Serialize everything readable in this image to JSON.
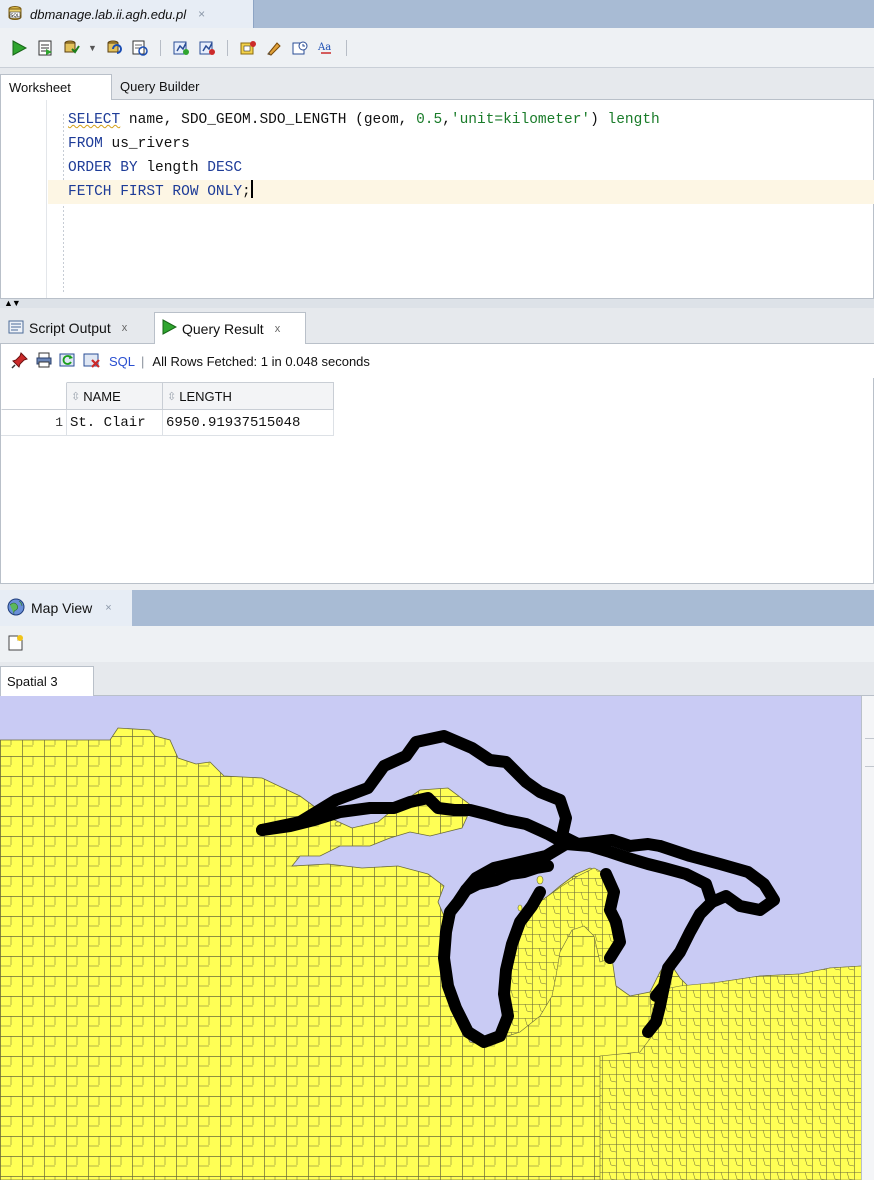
{
  "document_tab": {
    "title": "dbmanage.lab.ii.agh.edu.pl",
    "close": "×"
  },
  "toolbar": {
    "buttons": [
      "run-statement-icon",
      "run-script-icon",
      "commit-icon",
      "rollback-icon",
      "explain-plan-icon",
      "autotrace-icon",
      "sql-tuning-icon",
      "monitor-icon",
      "sql-history-icon",
      "clear-icon",
      "find-icon",
      "format-icon"
    ]
  },
  "worksheet_tabs": {
    "worksheet": "Worksheet",
    "query_builder": "Query Builder"
  },
  "editor": {
    "line1": {
      "kw1": "SELECT",
      "ident1": " name, SDO_GEOM.SDO_LENGTH (geom, ",
      "num": "0.5",
      "sep": ",",
      "str": "'unit=kilometer'",
      "close": ") ",
      "alias": "length"
    },
    "line2": {
      "kw": "FROM",
      "ident": " us_rivers"
    },
    "line3": {
      "kw": "ORDER BY",
      "ident": " length ",
      "kw2": "DESC"
    },
    "line4": {
      "kw": "FETCH FIRST ROW ONLY",
      "semi": ";"
    }
  },
  "output_tabs": {
    "script_output": "Script Output",
    "query_result": "Query Result",
    "close": "x"
  },
  "result_toolbar": {
    "sql_label": "SQL",
    "separator": "|",
    "status": "All Rows Fetched: 1 in 0.048 seconds"
  },
  "grid": {
    "columns": [
      "NAME",
      "LENGTH"
    ],
    "rows": [
      {
        "row_number": "1",
        "name": "St. Clair",
        "length": "6950.91937515048"
      }
    ]
  },
  "map_view": {
    "tab_title": "Map View",
    "close": "×",
    "spatial_tab": "Spatial 3",
    "colors": {
      "water": "#c9cbf4",
      "land": "#ffff55",
      "county_lines": "#6b6b3a",
      "river": "#000000"
    }
  }
}
